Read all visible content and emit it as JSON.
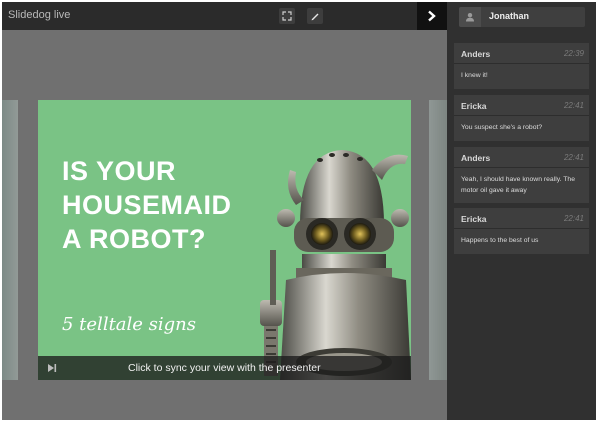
{
  "app": {
    "title": "Slidedog live"
  },
  "toolbar": {
    "fullscreen_icon": "fullscreen-icon",
    "pen_icon": "pen-icon",
    "collapse_icon": "chevron-right-icon"
  },
  "slide": {
    "title_lines": [
      "IS YOUR",
      "HOUSEMAID",
      "A ROBOT?"
    ],
    "subtitle": "5 telltale signs",
    "image": "robot-illustration"
  },
  "sync": {
    "label": "Click to sync your view with the presenter",
    "icon": "skip-to-end-icon"
  },
  "user": {
    "name": "Jonathan",
    "icon": "user-icon"
  },
  "chat": {
    "messages": [
      {
        "name": "Anders",
        "time": "22:39",
        "text": "I knew it!"
      },
      {
        "name": "Ericka",
        "time": "22:41",
        "text": "You suspect she's a robot?"
      },
      {
        "name": "Anders",
        "time": "22:41",
        "text": "Yeah, I should have known really. The motor oil gave it away"
      },
      {
        "name": "Ericka",
        "time": "22:41",
        "text": "Happens to the best of us"
      }
    ]
  },
  "colors": {
    "slide_bg": "#7ac385",
    "topbar": "#2b2b2b",
    "sidebar": "#303030",
    "stage": "#707070"
  }
}
